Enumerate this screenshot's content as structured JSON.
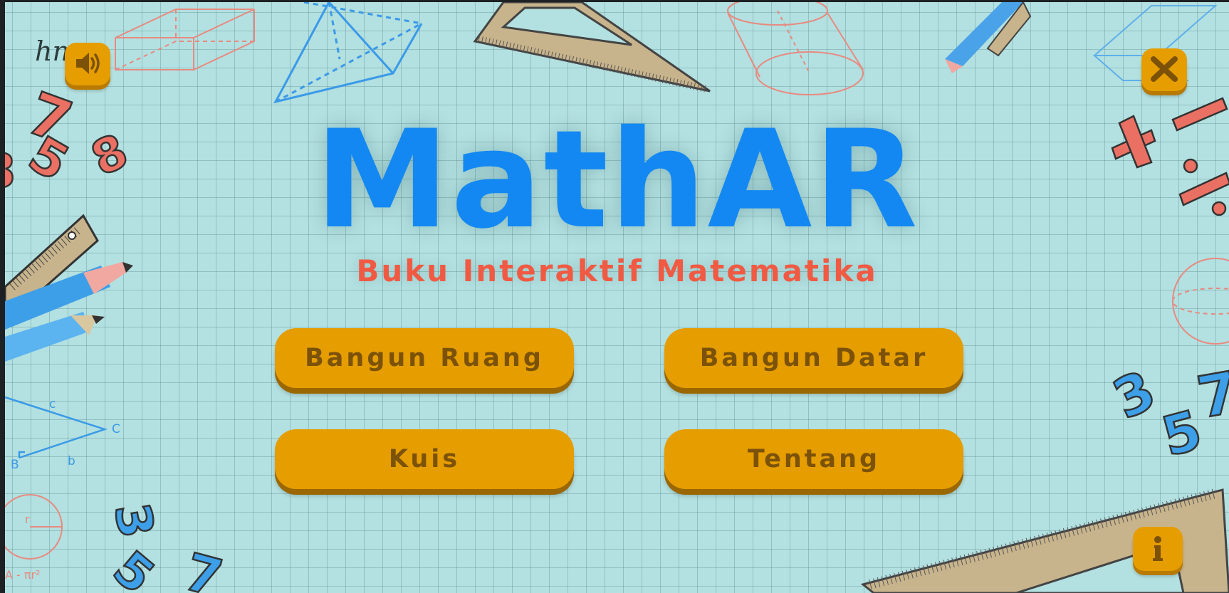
{
  "app": {
    "title": "MathAR",
    "subtitle": "Buku Interaktif Matematika"
  },
  "menu": {
    "items": [
      {
        "label": "Bangun Ruang"
      },
      {
        "label": "Bangun Datar"
      },
      {
        "label": "Kuis"
      },
      {
        "label": "Tentang"
      }
    ]
  },
  "controls": {
    "sound_icon": "speaker-icon",
    "close_icon": "close-icon",
    "info_icon": "info-icon"
  },
  "decorations": {
    "digits": [
      "7",
      "5",
      "8",
      "3",
      "5",
      "7",
      "3",
      "5",
      "7"
    ],
    "symbols": [
      "+",
      "−",
      "÷"
    ],
    "formula_labels": [
      "hm",
      "c",
      "C",
      "B",
      "b",
      "r",
      "A - πr²"
    ]
  },
  "colors": {
    "background": "#b3e0e0",
    "title": "#1388f2",
    "subtitle": "#f05a43",
    "button": "#e59d00",
    "button_text": "#7b5208"
  }
}
